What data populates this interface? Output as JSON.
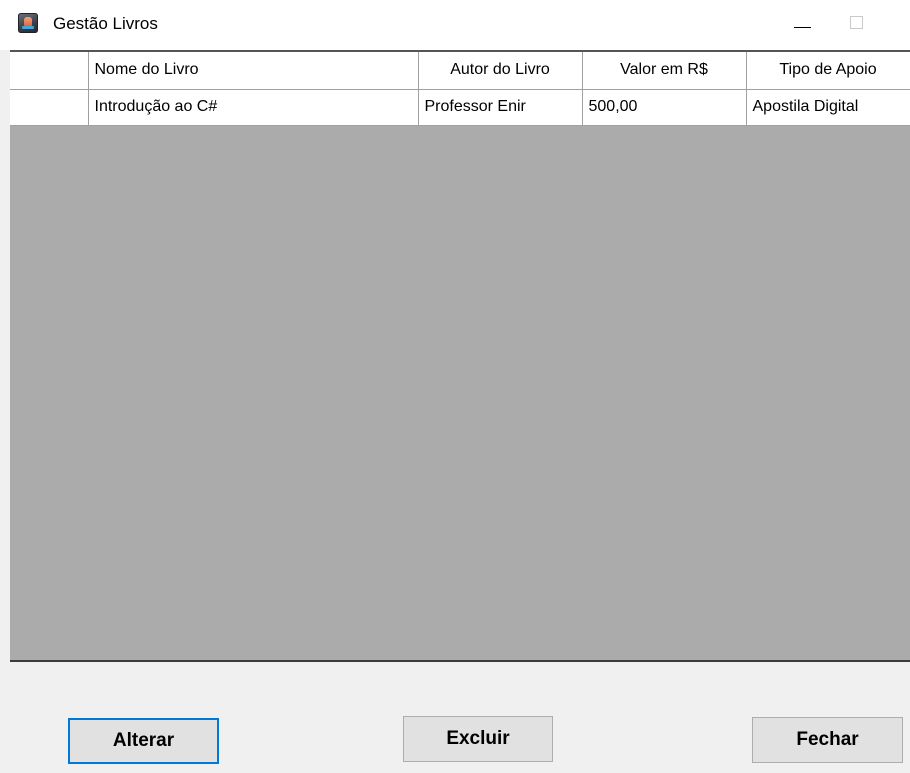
{
  "window": {
    "title": "Gestão Livros",
    "icon": "app-icon"
  },
  "grid": {
    "columns": [
      "Nome do Livro",
      "Autor do Livro",
      "Valor em R$",
      "Tipo de Apoio"
    ],
    "rows": [
      [
        "Introdução ao C#",
        "Professor Enir",
        "500,00",
        "Apostila Digital"
      ]
    ],
    "empty_area_color": "#ababab"
  },
  "buttons": {
    "alterar": "Alterar",
    "excluir": "Excluir",
    "fechar": "Fechar",
    "focus_color": "#0078d7"
  }
}
